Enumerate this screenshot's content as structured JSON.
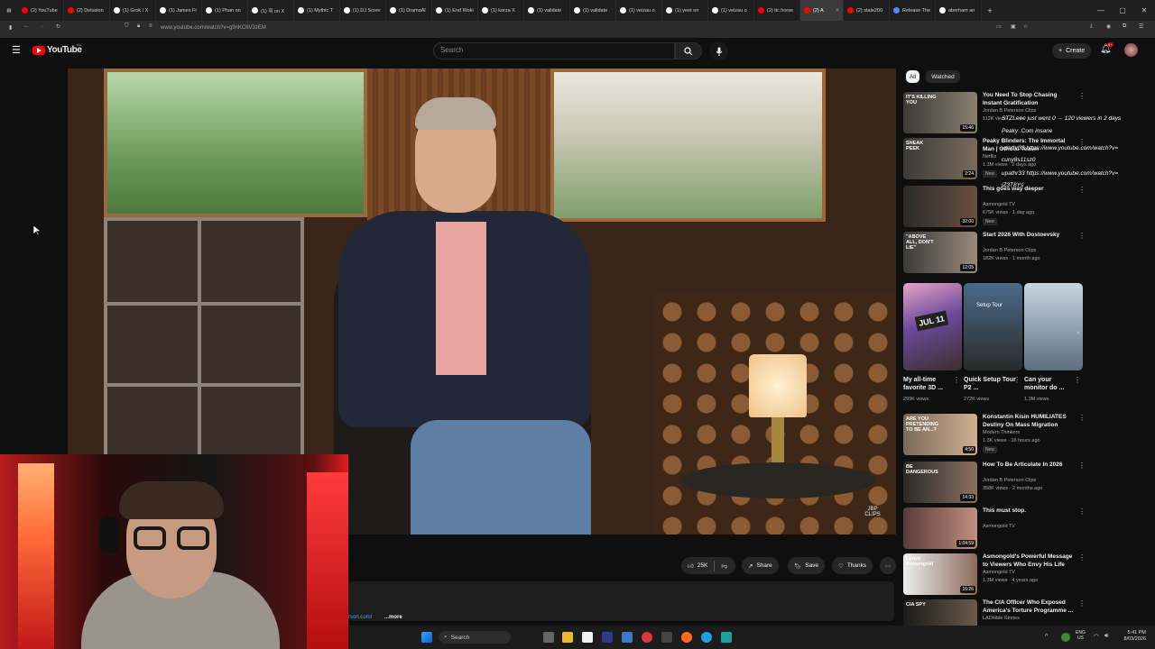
{
  "browser": {
    "tabs": [
      {
        "label": "(2) YouTube",
        "color": "#ff0000"
      },
      {
        "label": "(2) Delusion",
        "color": "#ff0000"
      },
      {
        "label": "(1) Grok / X",
        "color": "#ffffff"
      },
      {
        "label": "(1) James Fr",
        "color": "#ffffff"
      },
      {
        "label": "(1) Phan on",
        "color": "#ffffff"
      },
      {
        "label": "(1) 뭐 on X",
        "color": "#ffffff"
      },
      {
        "label": "(1) Mythic T",
        "color": "#ffffff"
      },
      {
        "label": "(1) DJ Screv",
        "color": "#ffffff"
      },
      {
        "label": "(1) DramaAl",
        "color": "#ffffff"
      },
      {
        "label": "(1) End Woki",
        "color": "#ffffff"
      },
      {
        "label": "(1) korza X",
        "color": "#ffffff"
      },
      {
        "label": "(1) validate",
        "color": "#ffffff"
      },
      {
        "label": "(1) validate",
        "color": "#ffffff"
      },
      {
        "label": "(1) veizau o",
        "color": "#ffffff"
      },
      {
        "label": "(1) yeet on",
        "color": "#ffffff"
      },
      {
        "label": "(1) veizau o",
        "color": "#ffffff"
      },
      {
        "label": "(2) tic horse",
        "color": "#ff0000"
      },
      {
        "label": "(2) A",
        "color": "#ff0000",
        "active": true
      },
      {
        "label": "(2) stale200",
        "color": "#ff0000"
      },
      {
        "label": "Release The",
        "color": "#4a8cff"
      },
      {
        "label": "aberham an",
        "color": "#ffffff"
      }
    ],
    "url": "www.youtube.com/watch?v=g9nKC6V3zEM"
  },
  "youtube": {
    "logo": "YouTube",
    "logo_sup": "AU",
    "search_placeholder": "Search",
    "create_label": "Create",
    "notif_count": "9+",
    "chips": [
      "All",
      "Watched"
    ]
  },
  "video": {
    "watermark": "JBP CLIPS"
  },
  "actions": {
    "likes": "25K",
    "share": "Share",
    "save": "Save",
    "thanks": "Thanks"
  },
  "description": {
    "link_fragment": "rson.com/",
    "more": "...more"
  },
  "recommendations": [
    {
      "title": "You Need To Stop Chasing Instant Gratification",
      "channel": "Jordan B Peterson Clips",
      "meta": "112K views",
      "duration": "15:46",
      "thumb_text": "IT'S KILLING YOU"
    },
    {
      "title": "Peaky Blinders: The Immortal Man | Official Teaser",
      "channel": "Netflix",
      "meta": "1.3M views · 2 days ago",
      "duration": "2:24",
      "badge": "New",
      "thumb_text": "SNEAK PEEK"
    },
    {
      "title": "This goes way deeper",
      "channel": "Asmongold TV",
      "meta": "675K views · 1 day ago",
      "duration": "32:00",
      "badge": "New"
    },
    {
      "title": "Start 2026 With Dostoevsky",
      "channel": "Jordan B Peterson Clips",
      "meta": "182K views · 1 month ago",
      "duration": "12:05",
      "thumb_text": "\"ABOVE ALL, DON'T LIE\""
    },
    {
      "title": "Konstantin Kisin HUMILIATES Destiny On Mass Migration",
      "channel": "Modern Thinkers",
      "meta": "1.3K views · 16 hours ago",
      "duration": "4:50",
      "badge": "New",
      "thumb_text": "ARE YOU PRETENDING TO BE AN...?"
    },
    {
      "title": "How To Be Articulate In 2026",
      "channel": "Jordan B Peterson Clips",
      "meta": "358K views · 2 months ago",
      "duration": "14:33",
      "thumb_text": "BE DANGEROUS"
    },
    {
      "title": "This must stop.",
      "channel": "Asmongold TV",
      "meta": "",
      "duration": "1:04:59"
    },
    {
      "title": "Asmongold's Powerful Message to Viewers Who Envy His Life",
      "channel": "Asmongold TV",
      "meta": "1.3M views · 4 years ago",
      "duration": "16:26",
      "thumb_text": "I Envy Asmongold"
    },
    {
      "title": "The CIA Officer Who Exposed America's Torture Programme ...",
      "channel": "LADbible Stories",
      "meta": "",
      "duration": "",
      "thumb_text": "CIA SPY"
    }
  ],
  "shorts": [
    {
      "title": "My all-time favorite 3D ...",
      "views": "299K views",
      "thumb_text": "JUL 11"
    },
    {
      "title": "Quick Setup Tour P2 ...",
      "views": "272K views",
      "thumb_text": "Setup Tour"
    },
    {
      "title": "Can your monitor do ...",
      "views": "1.3M views",
      "thumb_text": ""
    }
  ],
  "chat_overlay": [
    {
      "text": "STZLeee  just went 0 → 120 viewers in 2 days"
    },
    {
      "text": "Peaky .Com  insane"
    },
    {
      "text": "upathr33  https://www.youtube.com/watch?v="
    },
    {
      "text": "cuny8s11sz0"
    },
    {
      "text": "upathr33  https://www.youtube.com/watch?v="
    },
    {
      "text": "jZ3T8Ys"
    }
  ],
  "taskbar": {
    "search": "Search",
    "time": "5:41 PM",
    "date": "8/03/2026",
    "lang": "ENG",
    "region": "US"
  },
  "colors": {
    "yt_red": "#ff0000",
    "bg": "#0f0f0f",
    "chip_active": "#f1f1f1"
  }
}
